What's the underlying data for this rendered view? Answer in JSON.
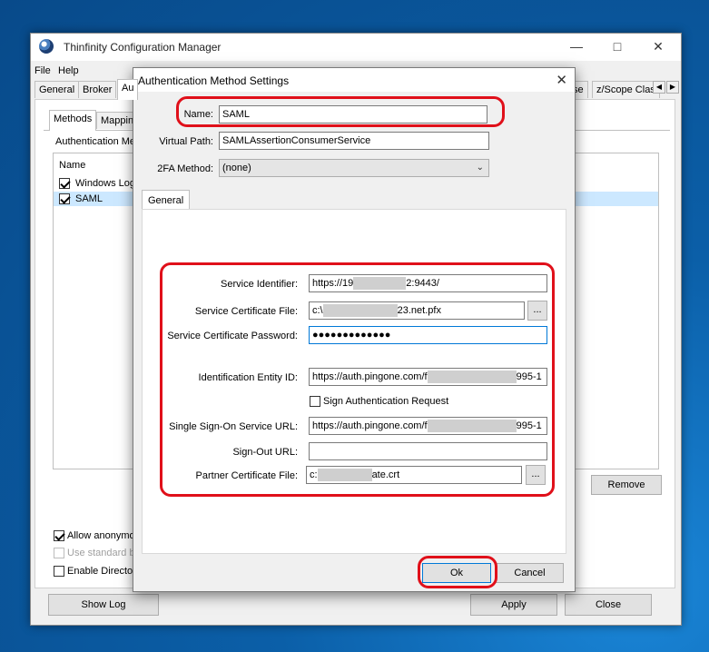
{
  "main_window": {
    "title": "Thinfinity Configuration Manager",
    "menu": [
      "File",
      "Help"
    ],
    "tabs": [
      "General",
      "Broker",
      "Au"
    ],
    "tabs_right": [
      "se",
      "z/Scope Clas"
    ],
    "subtabs": [
      "Methods",
      "Mapping"
    ],
    "auth_methods_label": "Authentication Me",
    "list_header": "Name",
    "methods": [
      {
        "label": "Windows Logo",
        "checked": true
      },
      {
        "label": "SAML",
        "checked": true
      }
    ],
    "remove_label": "Remove",
    "allow_anonymous": "Allow anonymou",
    "use_standard": "Use standard br",
    "enable_directory": "Enable Director",
    "show_log_label": "Show Log",
    "apply_label": "Apply",
    "close_label": "Close"
  },
  "dialog": {
    "title": "Authentication Method Settings",
    "name_label": "Name:",
    "name_value": "SAML",
    "virtual_path_label": "Virtual Path:",
    "virtual_path_value": "SAMLAssertionConsumerService",
    "twofa_label": "2FA Method:",
    "twofa_value": "(none)",
    "tab_general": "General",
    "service_identifier_label": "Service Identifier:",
    "service_identifier_start": "https://19",
    "service_identifier_end": "2:9443/",
    "service_cert_file_label": "Service Certificate File:",
    "service_cert_file_start": "c:\\",
    "service_cert_file_end": "23.net.pfx",
    "service_cert_password_label": "Service Certificate Password:",
    "service_cert_password_value": "●●●●●●●●●●●●●",
    "identification_entity_label": "Identification Entity ID:",
    "identification_entity_start": "https://auth.pingone.com/f",
    "identification_entity_end": "995-1",
    "sign_auth_request_label": "Sign Authentication Request",
    "sso_url_label": "Single Sign-On Service URL:",
    "sso_url_start": "https://auth.pingone.com/f",
    "sso_url_end": "995-1",
    "signout_url_label": "Sign-Out URL:",
    "partner_cert_label": "Partner Certificate File:",
    "partner_cert_start": "c:",
    "partner_cert_end": "ate.crt",
    "browse_label": "...",
    "ok_label": "Ok",
    "cancel_label": "Cancel"
  },
  "colors": {
    "highlight": "#e0101a",
    "selection": "#cce8ff",
    "focus": "#0078d7"
  }
}
